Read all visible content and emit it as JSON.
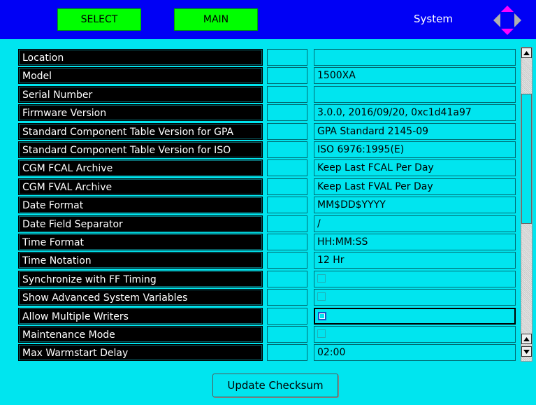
{
  "header": {
    "select_label": "SELECT",
    "main_label": "MAIN",
    "title": "System"
  },
  "rows": [
    {
      "label": "Location",
      "value": "",
      "kind": "text"
    },
    {
      "label": "Model",
      "value": "1500XA",
      "kind": "text"
    },
    {
      "label": "Serial Number",
      "value": "",
      "kind": "text"
    },
    {
      "label": "Firmware Version",
      "value": "3.0.0, 2016/09/20, 0xc1d41a97",
      "kind": "text"
    },
    {
      "label": "Standard Component Table Version for GPA",
      "value": "GPA Standard 2145-09",
      "kind": "text"
    },
    {
      "label": "Standard Component Table Version for ISO",
      "value": "ISO 6976:1995(E)",
      "kind": "text"
    },
    {
      "label": "CGM FCAL Archive",
      "value": "Keep Last FCAL Per Day",
      "kind": "text"
    },
    {
      "label": "CGM FVAL Archive",
      "value": "Keep Last FVAL Per Day",
      "kind": "text"
    },
    {
      "label": "Date Format",
      "value": "MM$DD$YYYY",
      "kind": "text"
    },
    {
      "label": "Date Field Separator",
      "value": "/",
      "kind": "text"
    },
    {
      "label": "Time Format",
      "value": "HH:MM:SS",
      "kind": "text"
    },
    {
      "label": "Time Notation",
      "value": "12 Hr",
      "kind": "text"
    },
    {
      "label": "Synchronize with FF Timing",
      "value": false,
      "kind": "checkbox"
    },
    {
      "label": "Show Advanced System Variables",
      "value": false,
      "kind": "checkbox"
    },
    {
      "label": "Allow Multiple Writers",
      "value": false,
      "kind": "checkbox",
      "selected": true
    },
    {
      "label": "Maintenance Mode",
      "value": false,
      "kind": "checkbox"
    },
    {
      "label": "Max Warmstart Delay",
      "value": "02:00",
      "kind": "text"
    }
  ],
  "footer": {
    "update_label": "Update Checksum"
  },
  "colors": {
    "background": "#00e5ef",
    "header": "#0000f5",
    "button_green": "#00ff00",
    "dpad_magenta": "#ff00ff",
    "dpad_gray": "#b0b0b0"
  },
  "icons": {
    "nav": "dpad-arrows-icon",
    "scroll_up": "arrow-up-icon",
    "scroll_down": "arrow-down-icon"
  }
}
